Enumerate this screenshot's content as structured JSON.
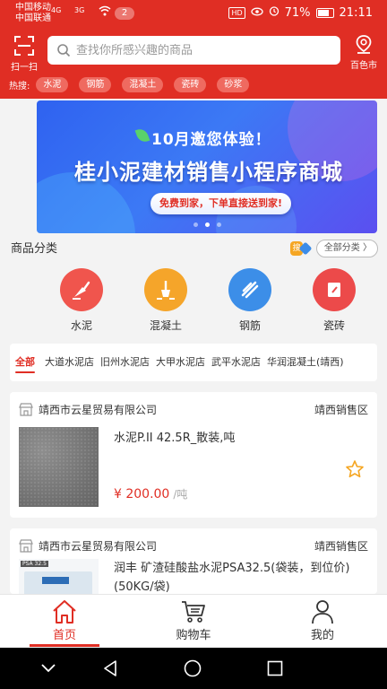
{
  "status_bar": {
    "carrier1": "中国移动",
    "carrier2": "中国联通",
    "signal1": "4G",
    "signal2": "3G",
    "notification_count": "2",
    "hd": "HD",
    "battery": "71%",
    "time": "21:11"
  },
  "header": {
    "scan_label": "扫一扫",
    "search_placeholder": "查找你所感兴趣的商品",
    "city": "百色市",
    "hot_label": "热搜:",
    "hot_tags": [
      "水泥",
      "钢筋",
      "混凝土",
      "瓷砖",
      "砂浆"
    ]
  },
  "banner": {
    "subtitle": "10月邀您体验！",
    "title": "桂小泥建材销售小程序商城",
    "cta": "免费到家，下单直接送到家!",
    "slide_count": 3,
    "active_slide": 2
  },
  "categories": {
    "title": "商品分类",
    "search_badge": "搜",
    "all_label": "全部分类 〉",
    "items": [
      {
        "label": "水泥",
        "icon": "trowel-icon",
        "color": "#f0554d"
      },
      {
        "label": "混凝土",
        "icon": "shovel-icon",
        "color": "#f5a52a"
      },
      {
        "label": "钢筋",
        "icon": "rebar-icon",
        "color": "#3c8ee8"
      },
      {
        "label": "瓷砖",
        "icon": "tile-icon",
        "color": "#ec4a4a"
      }
    ]
  },
  "store_tabs": [
    "全部",
    "大道水泥店",
    "旧州水泥店",
    "大甲水泥店",
    "武平水泥店",
    "华润混凝土(靖西)"
  ],
  "products": [
    {
      "store": "靖西市云星贸易有限公司",
      "region": "靖西销售区",
      "name": "水泥P.II 42.5R_散装,吨",
      "price": "¥ 200.00",
      "unit": "/吨"
    },
    {
      "store": "靖西市云星贸易有限公司",
      "region": "靖西销售区",
      "name": "润丰 矿渣硅酸盐水泥PSA32.5(袋装，到位价) (50KG/袋)",
      "thumb_label": "PSA 32.5"
    }
  ],
  "tabbar": [
    {
      "label": "首页",
      "icon": "home-icon",
      "active": true
    },
    {
      "label": "购物车",
      "icon": "cart-icon",
      "active": false
    },
    {
      "label": "我的",
      "icon": "user-icon",
      "active": false
    }
  ],
  "colors": {
    "brand": "#e02e24",
    "accent_star": "#f5a623"
  }
}
